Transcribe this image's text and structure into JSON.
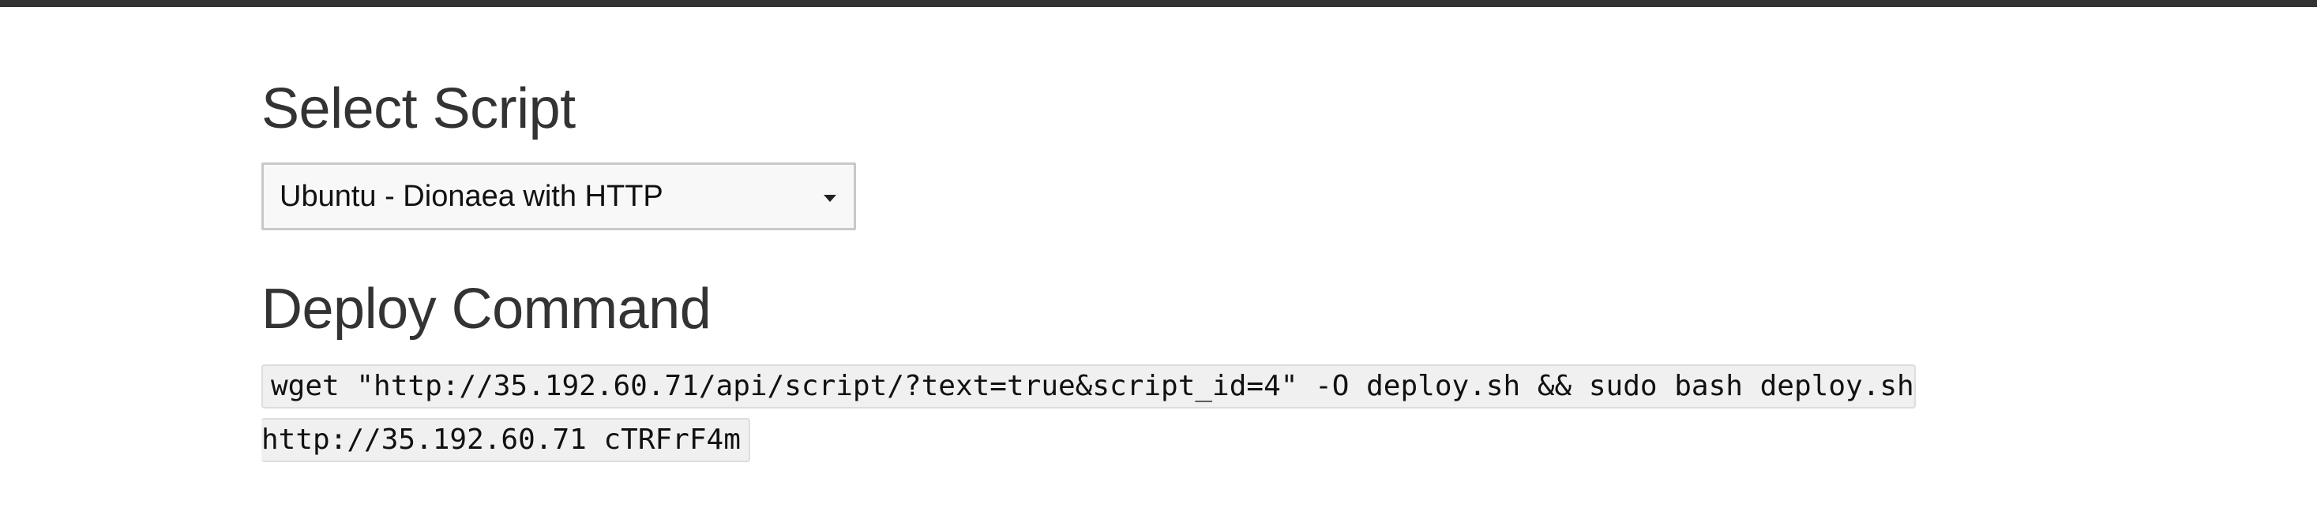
{
  "select_section": {
    "title": "Select Script",
    "selected_value": "Ubuntu - Dionaea with HTTP"
  },
  "deploy_section": {
    "title": "Deploy Command",
    "command_line_1": "wget \"http://35.192.60.71/api/script/?text=true&script_id=4\" -O deploy.sh && sudo bash deploy.sh",
    "command_line_2": "http://35.192.60.71 cTRFrF4m"
  },
  "icons": {
    "select_caret": "caret-down-icon"
  },
  "colors": {
    "topbar": "#333333",
    "heading_text": "#333333",
    "code_background": "#f0f0f0"
  }
}
